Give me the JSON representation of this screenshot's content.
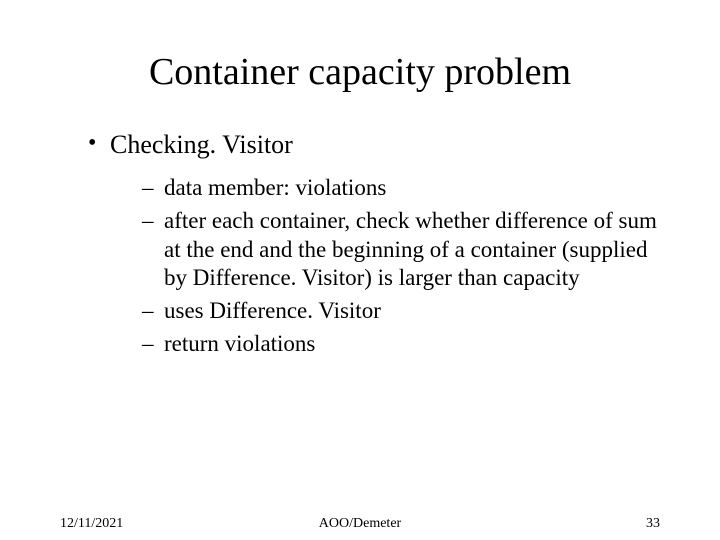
{
  "title": "Container capacity problem",
  "bullets": {
    "level1": [
      {
        "text": "Checking. Visitor"
      }
    ],
    "level2": [
      {
        "text": "data member: violations"
      },
      {
        "text": "after each container, check whether difference of sum at the end and the beginning of a container (supplied by Difference. Visitor) is larger than capacity"
      },
      {
        "text": "uses Difference. Visitor"
      },
      {
        "text": "return violations"
      }
    ]
  },
  "footer": {
    "date": "12/11/2021",
    "center": "AOO/Demeter",
    "page": "33"
  }
}
